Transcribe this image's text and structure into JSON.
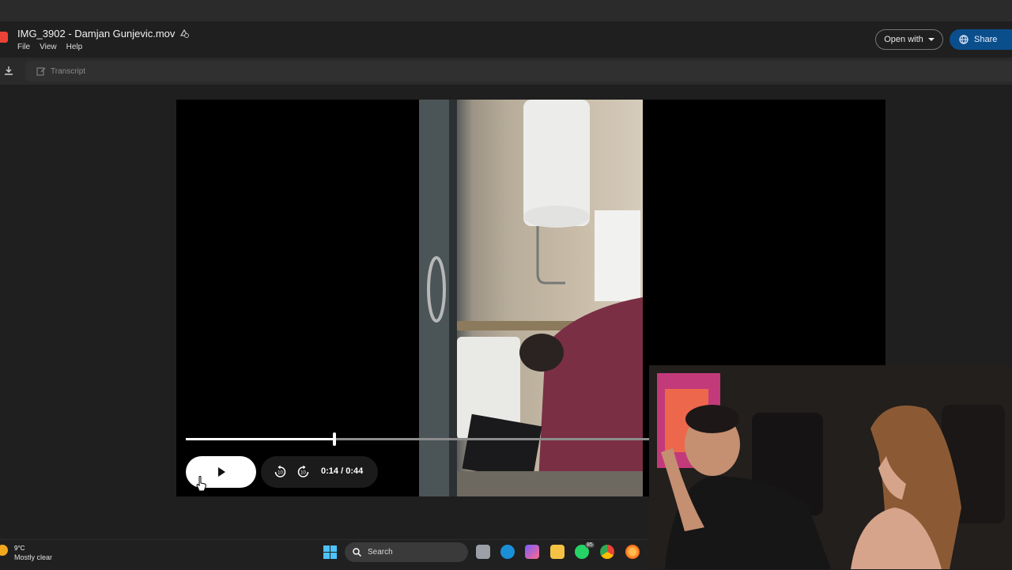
{
  "window": {
    "title": "IMG_3902 - Damjan Gunjevic.mov"
  },
  "menu": [
    "File",
    "View",
    "Help"
  ],
  "header": {
    "open_with_label": "Open with",
    "share_label": "Share"
  },
  "toolbar": {
    "transcript_label": "Transcript"
  },
  "player": {
    "current_time": "0:14",
    "duration_text": "/ 0:44",
    "progress": 0.318
  },
  "taskbar": {
    "weather_temp": "9°C",
    "weather_condition": "Mostly clear",
    "search_placeholder": "Search",
    "whatsapp_badge": "85"
  },
  "colors": {
    "share_button": "#0b4e8c",
    "background": "#1f1f1f",
    "accent": "#4cc2ff"
  }
}
